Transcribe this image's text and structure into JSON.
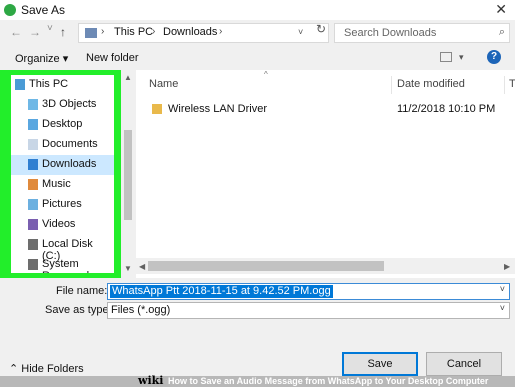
{
  "window": {
    "title": "Save As",
    "close_glyph": "✕"
  },
  "address": {
    "back_glyph": "←",
    "forward_glyph": "→",
    "history_glyph": "˅",
    "up_glyph": "↑",
    "path_sep_glyph": "›",
    "breadcrumbs": [
      "This PC",
      "Downloads"
    ],
    "refresh_glyph": "↻",
    "search_placeholder": "Search Downloads",
    "search_glyph": "⌕"
  },
  "toolbar": {
    "organize_label": "Organize ▾",
    "new_folder_label": "New folder",
    "help_glyph": "?",
    "view_caret": "▾"
  },
  "nav": {
    "up_arrow": "▲",
    "down_arrow": "▼",
    "items": [
      {
        "label": "This PC",
        "icon": "monitor-icon",
        "color": "#4a9bd6"
      },
      {
        "label": "3D Objects",
        "icon": "cube-icon",
        "color": "#6fb8e6"
      },
      {
        "label": "Desktop",
        "icon": "desktop-folder-icon",
        "color": "#5aa7e0"
      },
      {
        "label": "Documents",
        "icon": "documents-icon",
        "color": "#c8d6e6"
      },
      {
        "label": "Downloads",
        "icon": "download-icon",
        "color": "#2f7fd1"
      },
      {
        "label": "Music",
        "icon": "music-icon",
        "color": "#e08a3c"
      },
      {
        "label": "Pictures",
        "icon": "pictures-icon",
        "color": "#6cb0e0"
      },
      {
        "label": "Videos",
        "icon": "videos-icon",
        "color": "#7a5fb0"
      },
      {
        "label": "Local Disk (C:)",
        "icon": "disk-icon",
        "color": "#6d6d6d"
      },
      {
        "label": "System Reserved",
        "icon": "disk-icon",
        "color": "#6d6d6d"
      }
    ],
    "selected_index": 4
  },
  "filelist": {
    "columns": [
      "Name",
      "Date modified",
      "T"
    ],
    "sort_glyph": "^",
    "rows": [
      {
        "name": "Wireless LAN Driver",
        "date": "11/2/2018 10:10 PM"
      }
    ],
    "left_arrow": "◀",
    "right_arrow": "▶"
  },
  "form": {
    "filename_label": "File name:",
    "filename_value": "WhatsApp Ptt 2018-11-15 at 9.42.52 PM.ogg",
    "type_label": "Save as type:",
    "type_value": "Files (*.ogg)",
    "caret_glyph": "˅"
  },
  "footer": {
    "hide_folders_label": "⌃ Hide Folders",
    "save_label": "Save",
    "cancel_label": "Cancel"
  },
  "caption": {
    "logo": "wiki",
    "text": "How to Save an Audio Message from WhatsApp to Your Desktop Computer"
  }
}
